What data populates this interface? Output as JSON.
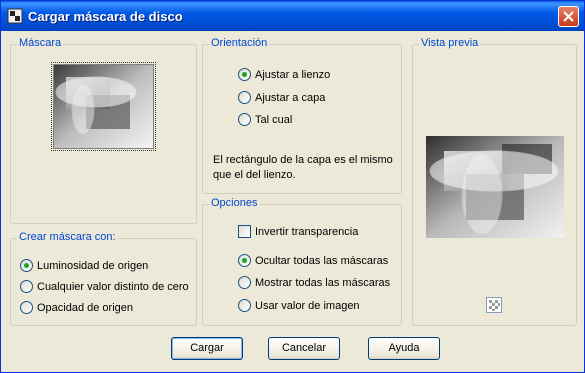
{
  "window": {
    "title": "Cargar máscara de disco"
  },
  "mascara_group": {
    "legend": "Máscara"
  },
  "crear_group": {
    "legend": "Crear máscara con:",
    "options": [
      {
        "label": "Luminosidad de origen",
        "selected": true
      },
      {
        "label": "Cualquier valor distinto de cero",
        "selected": false
      },
      {
        "label": "Opacidad de origen",
        "selected": false
      }
    ]
  },
  "orientacion_group": {
    "legend": "Orientación",
    "options": [
      {
        "label": "Ajustar a lienzo",
        "selected": true
      },
      {
        "label": "Ajustar a capa",
        "selected": false
      },
      {
        "label": "Tal cual",
        "selected": false
      }
    ],
    "note": "El rectángulo de la capa es el mismo que el del lienzo."
  },
  "opciones_group": {
    "legend": "Opciones",
    "invert_label": "Invertir transparencia",
    "invert_checked": false,
    "options": [
      {
        "label": "Ocultar todas las máscaras",
        "selected": true
      },
      {
        "label": "Mostrar todas las máscaras",
        "selected": false
      },
      {
        "label": "Usar valor de imagen",
        "selected": false
      }
    ]
  },
  "vista_previa_group": {
    "legend": "Vista previa"
  },
  "buttons": {
    "ok": "Cargar",
    "cancel": "Cancelar",
    "help": "Ayuda"
  },
  "icons": {
    "app": "psp-app-icon",
    "close": "close-icon",
    "swatch": "checkerboard-icon"
  }
}
